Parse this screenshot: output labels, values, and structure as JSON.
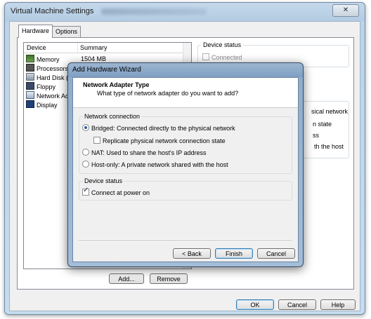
{
  "window": {
    "title": "Virtual Machine Settings",
    "close_glyph": "✕"
  },
  "tabs": [
    {
      "label": "Hardware",
      "active": true
    },
    {
      "label": "Options",
      "active": false
    }
  ],
  "device_list": {
    "columns": [
      "Device",
      "Summary"
    ],
    "rows": [
      {
        "device": "Memory",
        "summary": "1504 MB",
        "icon": "memory-icon"
      },
      {
        "device": "Processors",
        "summary": "",
        "icon": "processor-icon"
      },
      {
        "device": "Hard Disk (SC",
        "summary": "",
        "icon": "hard-disk-icon"
      },
      {
        "device": "Floppy",
        "summary": "",
        "icon": "floppy-icon"
      },
      {
        "device": "Network Ada",
        "summary": "",
        "icon": "network-adapter-icon"
      },
      {
        "device": "Display",
        "summary": "",
        "icon": "display-icon"
      }
    ],
    "add_label": "Add...",
    "remove_label": "Remove"
  },
  "right_panel": {
    "device_status_label": "Device status",
    "connected_label": "Connected",
    "fragments": [
      "sical network",
      "n state",
      "ss",
      "th the host"
    ]
  },
  "footer": {
    "ok": "OK",
    "cancel": "Cancel",
    "help": "Help"
  },
  "wizard": {
    "title": "Add Hardware Wizard",
    "heading": "Network Adapter Type",
    "subheading": "What type of network adapter do you want to add?",
    "network_group_label": "Network connection",
    "options": {
      "bridged": "Bridged: Connected directly to the physical network",
      "replicate": "Replicate physical network connection state",
      "nat": "NAT: Used to share the host's IP address",
      "hostonly": "Host-only: A private network shared with the host"
    },
    "selected_option": "bridged",
    "replicate_checked": false,
    "device_status_label": "Device status",
    "connect_at_power_on": "Connect at power on",
    "connect_checked": true,
    "buttons": {
      "back": "< Back",
      "finish": "Finish",
      "cancel": "Cancel"
    }
  }
}
